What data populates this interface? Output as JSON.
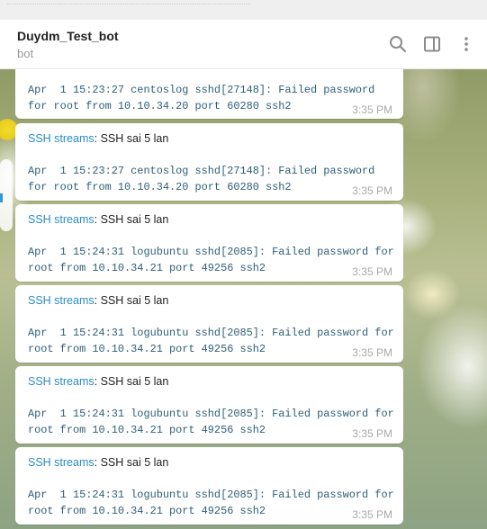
{
  "header": {
    "title": "Duydm_Test_bot",
    "subtitle": "bot"
  },
  "messages": [
    {
      "sender": "",
      "text": "",
      "lines": [
        "Apr  1 15:23:27 centoslog sshd[27148]: Failed password",
        "for root from 10.10.34.20 port 60280 ssh2"
      ],
      "time": "3:35 PM"
    },
    {
      "sender": "SSH streams",
      "text": ": SSH sai 5 lan",
      "lines": [
        "Apr  1 15:23:27 centoslog sshd[27148]: Failed password",
        "for root from 10.10.34.20 port 60280 ssh2"
      ],
      "time": "3:35 PM"
    },
    {
      "sender": "SSH streams",
      "text": ": SSH sai 5 lan",
      "lines": [
        "Apr  1 15:24:31 logubuntu sshd[2085]: Failed password for",
        "root from 10.10.34.21 port 49256 ssh2"
      ],
      "time": "3:35 PM"
    },
    {
      "sender": "SSH streams",
      "text": ": SSH sai 5 lan",
      "lines": [
        "Apr  1 15:24:31 logubuntu sshd[2085]: Failed password for",
        "root from 10.10.34.21 port 49256 ssh2"
      ],
      "time": "3:35 PM"
    },
    {
      "sender": "SSH streams",
      "text": ": SSH sai 5 lan",
      "lines": [
        "Apr  1 15:24:31 logubuntu sshd[2085]: Failed password for",
        "root from 10.10.34.21 port 49256 ssh2"
      ],
      "time": "3:35 PM"
    },
    {
      "sender": "SSH streams",
      "text": ": SSH sai 5 lan",
      "lines": [
        "Apr  1 15:24:31 logubuntu sshd[2085]: Failed password for",
        "root from 10.10.34.21 port 49256 ssh2"
      ],
      "time": "3:35 PM"
    }
  ],
  "icons": {
    "search": "search-icon",
    "sidebar": "sidebar-toggle-icon",
    "more": "more-vertical-icon"
  },
  "colors": {
    "link": "#2a8bc4",
    "monospace_text": "#2f5f77",
    "time": "#a9a9a9"
  }
}
